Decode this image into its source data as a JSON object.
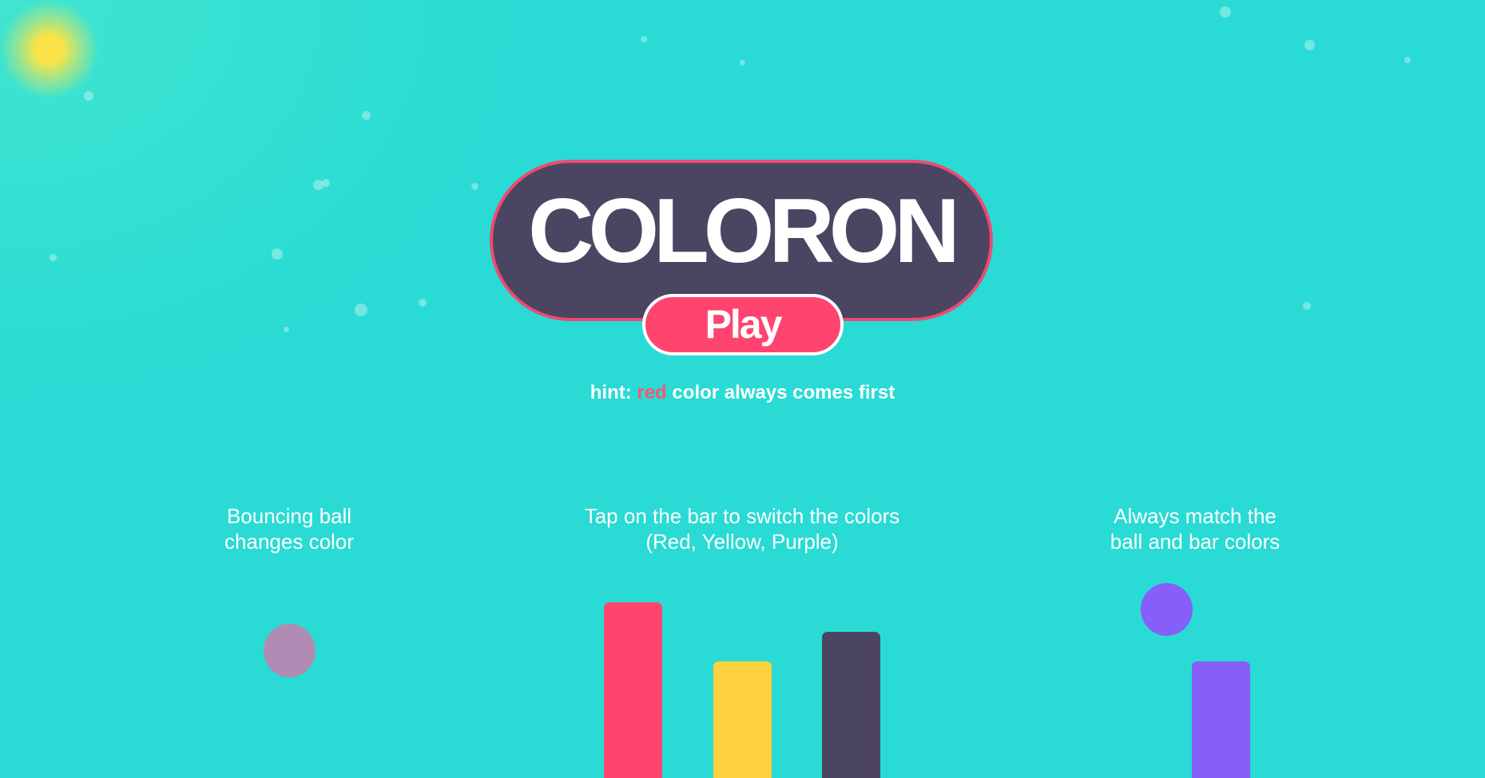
{
  "title": "COLORON",
  "play_button": "Play",
  "hint": {
    "prefix": "hint: ",
    "highlight": "red",
    "suffix": " color always comes first"
  },
  "instructions": [
    {
      "line1": "Bouncing ball",
      "line2": "changes color"
    },
    {
      "line1": "Tap on the bar to switch the colors",
      "line2": "(Red, Yellow, Purple)"
    },
    {
      "line1": "Always match the",
      "line2": "ball and bar colors"
    }
  ],
  "colors": {
    "background": "#29dbd4",
    "red": "#ff456f",
    "yellow": "#ffd03f",
    "dark": "#4b4562",
    "purple": "#855ff7",
    "faded_ball": "#b18bb4",
    "sun": "#fde047"
  }
}
